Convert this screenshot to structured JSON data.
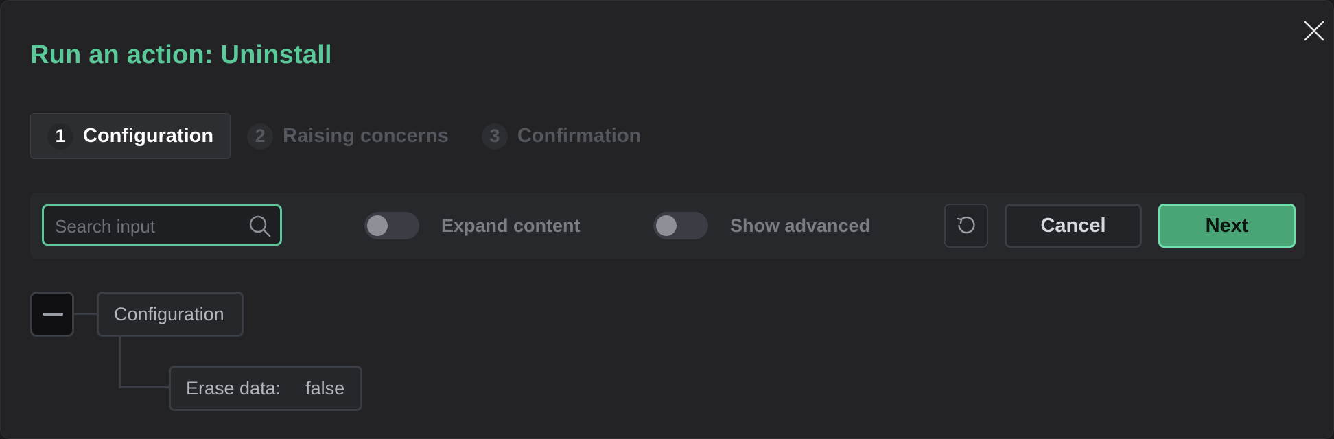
{
  "dialog": {
    "title": "Run an action: Uninstall"
  },
  "steps": [
    {
      "number": "1",
      "label": "Configuration",
      "active": true
    },
    {
      "number": "2",
      "label": "Raising concerns",
      "active": false
    },
    {
      "number": "3",
      "label": "Confirmation",
      "active": false
    }
  ],
  "toolbar": {
    "search_placeholder": "Search input",
    "search_value": "",
    "expand_label": "Expand content",
    "expand_on": false,
    "advanced_label": "Show advanced",
    "advanced_on": false,
    "cancel_label": "Cancel",
    "next_label": "Next"
  },
  "tree": {
    "root_label": "Configuration",
    "child": {
      "key": "Erase data:",
      "value": "false"
    }
  },
  "colors": {
    "accent": "#5bc99a",
    "primary_button": "#4aa576",
    "background": "#232325"
  },
  "icons": [
    "close-icon",
    "search-icon",
    "reset-icon",
    "collapse-icon"
  ]
}
